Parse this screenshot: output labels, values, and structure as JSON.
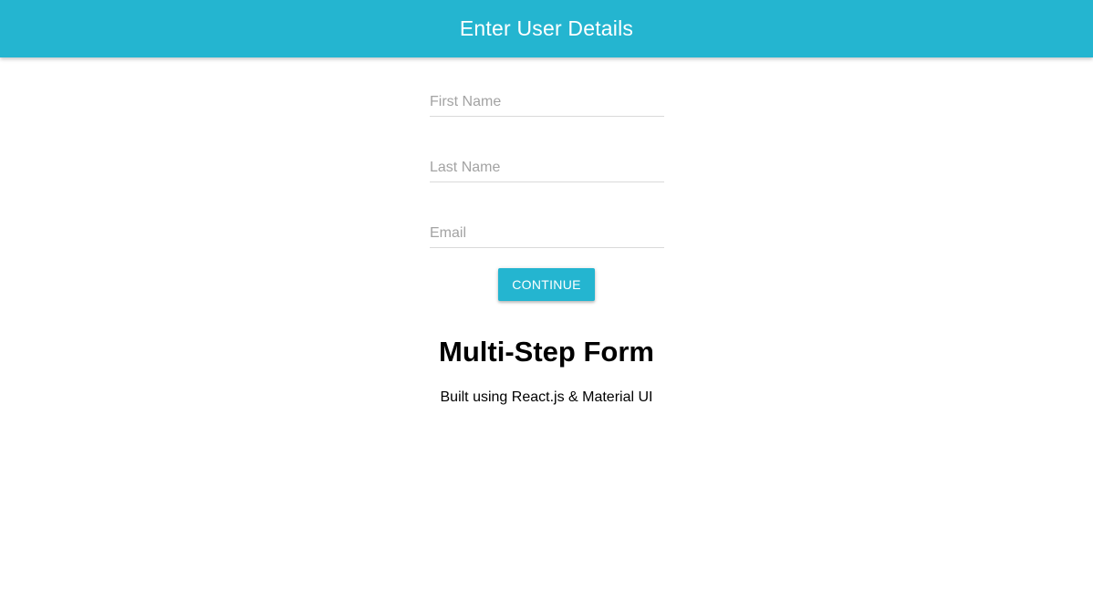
{
  "appbar": {
    "title": "Enter User Details",
    "color": "#24b5d0"
  },
  "form": {
    "fields": [
      {
        "placeholder": "First Name",
        "value": ""
      },
      {
        "placeholder": "Last Name",
        "value": ""
      },
      {
        "placeholder": "Email",
        "value": ""
      }
    ],
    "continue_label": "CONTINUE"
  },
  "footer": {
    "heading": "Multi-Step Form",
    "subtext": "Built using React.js & Material UI"
  }
}
